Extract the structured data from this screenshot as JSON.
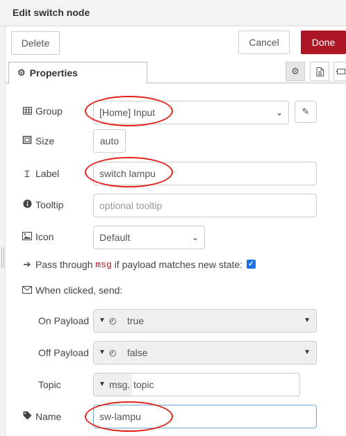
{
  "title": "Edit switch node",
  "buttons": {
    "delete": "Delete",
    "cancel": "Cancel",
    "done": "Done"
  },
  "tabs": {
    "properties": "Properties"
  },
  "icons": {
    "properties": "gear-icon",
    "settings": "gear-icon",
    "description": "document-icon",
    "appearance": "node-appearance-icon"
  },
  "fields": {
    "group": {
      "label": "Group",
      "value": "[Home] Input"
    },
    "size": {
      "label": "Size",
      "value": "auto"
    },
    "label": {
      "label": "Label",
      "value": "switch lampu"
    },
    "tooltip": {
      "label": "Tooltip",
      "placeholder": "optional tooltip"
    },
    "icon": {
      "label": "Icon",
      "value": "Default"
    },
    "passthrough": {
      "prefix": "Pass through",
      "code": "msg",
      "suffix": "if payload matches new state:",
      "checked": true
    },
    "when_clicked": {
      "label": "When clicked, send:"
    },
    "on_payload": {
      "label": "On Payload",
      "value": "true"
    },
    "off_payload": {
      "label": "Off Payload",
      "value": "false"
    },
    "topic": {
      "label": "Topic",
      "prefix": "msg.",
      "value": "topic"
    },
    "name": {
      "label": "Name",
      "value": "sw-lampu"
    }
  },
  "colors": {
    "done_button": "#ad1625",
    "annotation": "#e32219",
    "checkbox": "#1a73e8"
  }
}
